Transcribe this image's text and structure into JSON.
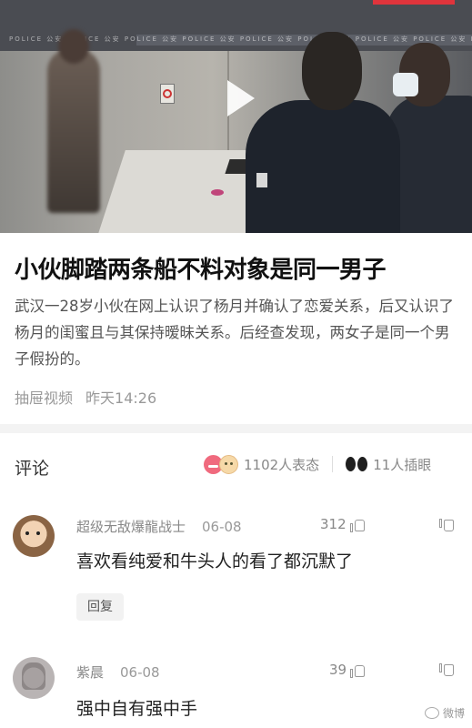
{
  "article": {
    "title": "小伙脚踏两条船不料对象是同一男子",
    "summary": "武汉一28岁小伙在网上认识了杨月并确认了恋爱关系，后又认识了杨月的闺蜜且与其保持暧昧关系。后经查发现，两女子是同一个男子假扮的。",
    "source": "抽屉视频",
    "time": "昨天14:26"
  },
  "video": {
    "watermark": "POLICE 公安 POLICE 公安 POLICE 公安 POLICE 公安 POLICE 公安 POLICE 公安 POLICE 公安 POLICE 公安 POLICE 公安"
  },
  "comments_header": {
    "label": "评论",
    "reactions": "1102人表态",
    "hints": "11人插眼"
  },
  "comments": [
    {
      "user": "超级无敌爆龍战士",
      "date": "06-08",
      "likes": "312",
      "text": "喜欢看纯爱和牛头人的看了都沉默了",
      "reply_label": "回复"
    },
    {
      "user": "紫晨",
      "date": "06-08",
      "likes": "39",
      "text": "强中自有强中手"
    }
  ],
  "watermark_bottom": "微博"
}
